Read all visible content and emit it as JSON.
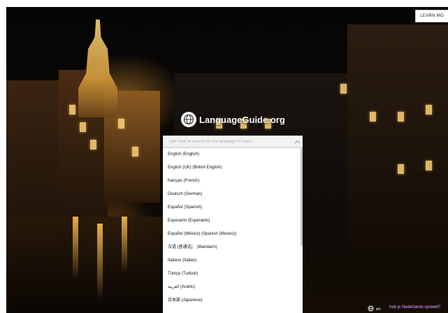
{
  "header": {
    "learn_more": "LEARN MO"
  },
  "brand": {
    "name": "LanguageGuide.org",
    "icon": "globe-icon"
  },
  "search": {
    "placeholder": "Type here to search for the language to learn...",
    "toggle_icon": "chevron-up-icon"
  },
  "languages": [
    "English (English)",
    "English (UK) (British English)",
    "français (French)",
    "Deutsch (German)",
    "Español (Spanish)",
    "Esperanto (Esperanto)",
    "Español (México) (Spanish (Mexico))",
    "汉语 (普通话)　(Mandarin)",
    "Italiano (Italian)",
    "Türkçe (Turkish)",
    "العربية (Arabic)",
    "日本語 (Japanese)"
  ],
  "footer": {
    "locale_icon": "globe-icon",
    "locale": "en",
    "prompt": "heb je Nederlands spreekt?"
  },
  "colors": {
    "prompt_link": "#e6a8ff",
    "dropdown_bg": "#ffffff"
  }
}
